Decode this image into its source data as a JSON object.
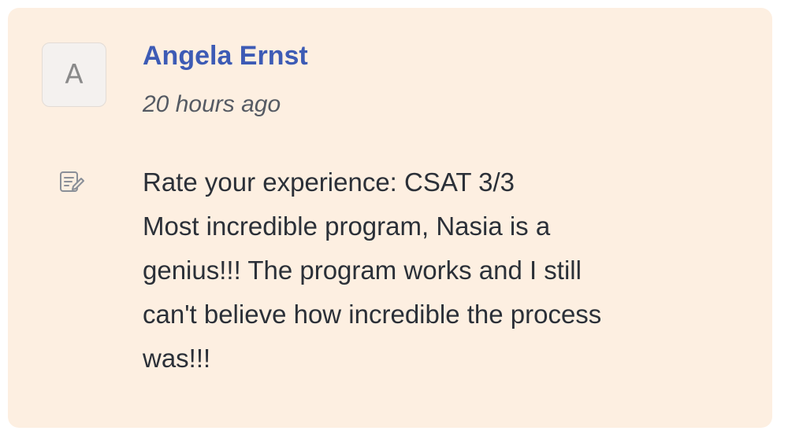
{
  "comment": {
    "avatar_initial": "A",
    "author": "Angela Ernst",
    "timestamp": "20 hours ago",
    "icon": "note-edit-icon",
    "body_lines": [
      "Rate your experience: CSAT 3/3",
      "Most incredible program, Nasia is a",
      "genius!!! The program works and I still",
      "can't believe how incredible the process",
      "was!!!"
    ]
  },
  "colors": {
    "card_background": "#fdefe1",
    "author_link": "#3d5bb5",
    "body_text": "#2b3038",
    "timestamp_text": "#555a63"
  }
}
